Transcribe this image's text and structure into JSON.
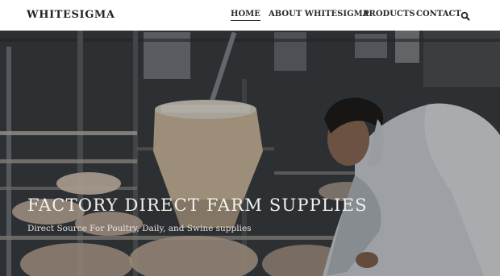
{
  "header": {
    "logo": "WHITESIGMA",
    "nav": [
      {
        "label": "HOME",
        "active": true
      },
      {
        "label": "ABOUT WHITESIGMA",
        "active": false
      },
      {
        "label": "PRODUCTS",
        "active": false
      },
      {
        "label": "CONTACT",
        "active": false
      }
    ],
    "search_icon": "search-icon"
  },
  "hero": {
    "title": "FACTORY DIRECT FARM SUPPLIES",
    "subtitle": "Direct Source For Poultry, Daily, and Swine supplies"
  }
}
